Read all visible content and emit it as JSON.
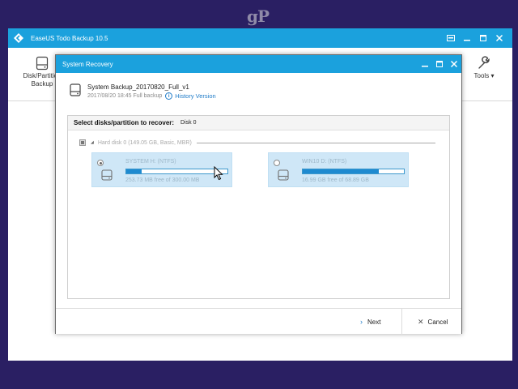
{
  "watermark": {
    "text": "gP"
  },
  "main_window": {
    "title": "EaseUS Todo Backup 10.5",
    "toolbar": {
      "disk_partition_backup_label": "Disk/Partition Backup",
      "tools_label": "Tools"
    }
  },
  "dialog": {
    "title": "System Recovery",
    "backup": {
      "name": "System Backup_20170820_Full_v1",
      "meta": "2017/08/20 18:45 Full backup",
      "history_link": "History Version"
    },
    "panel": {
      "title": "Select disks/partition to recover:",
      "disk_selected": "Disk 0",
      "disk_row_label": "Hard disk 0 (149.05 GB, Basic, MBR)",
      "partitions": [
        {
          "name": "SYSTEM H: (NTFS)",
          "free": "253.73 MB free of 300.00 MB",
          "used_fraction": 0.15,
          "selected": true
        },
        {
          "name": "WIN10 D: (NTFS)",
          "free": "16.99 GB free of 68.89 GB",
          "used_fraction": 0.75,
          "selected": false
        }
      ]
    },
    "footer": {
      "next_label": "Next",
      "cancel_label": "Cancel"
    }
  },
  "colors": {
    "titlebar": "#1ba1dd",
    "desktop": "#2a1f63",
    "partition_card": "#cfe7f7",
    "progress_fill": "#1e8ad0",
    "link": "#1e7bc8"
  }
}
